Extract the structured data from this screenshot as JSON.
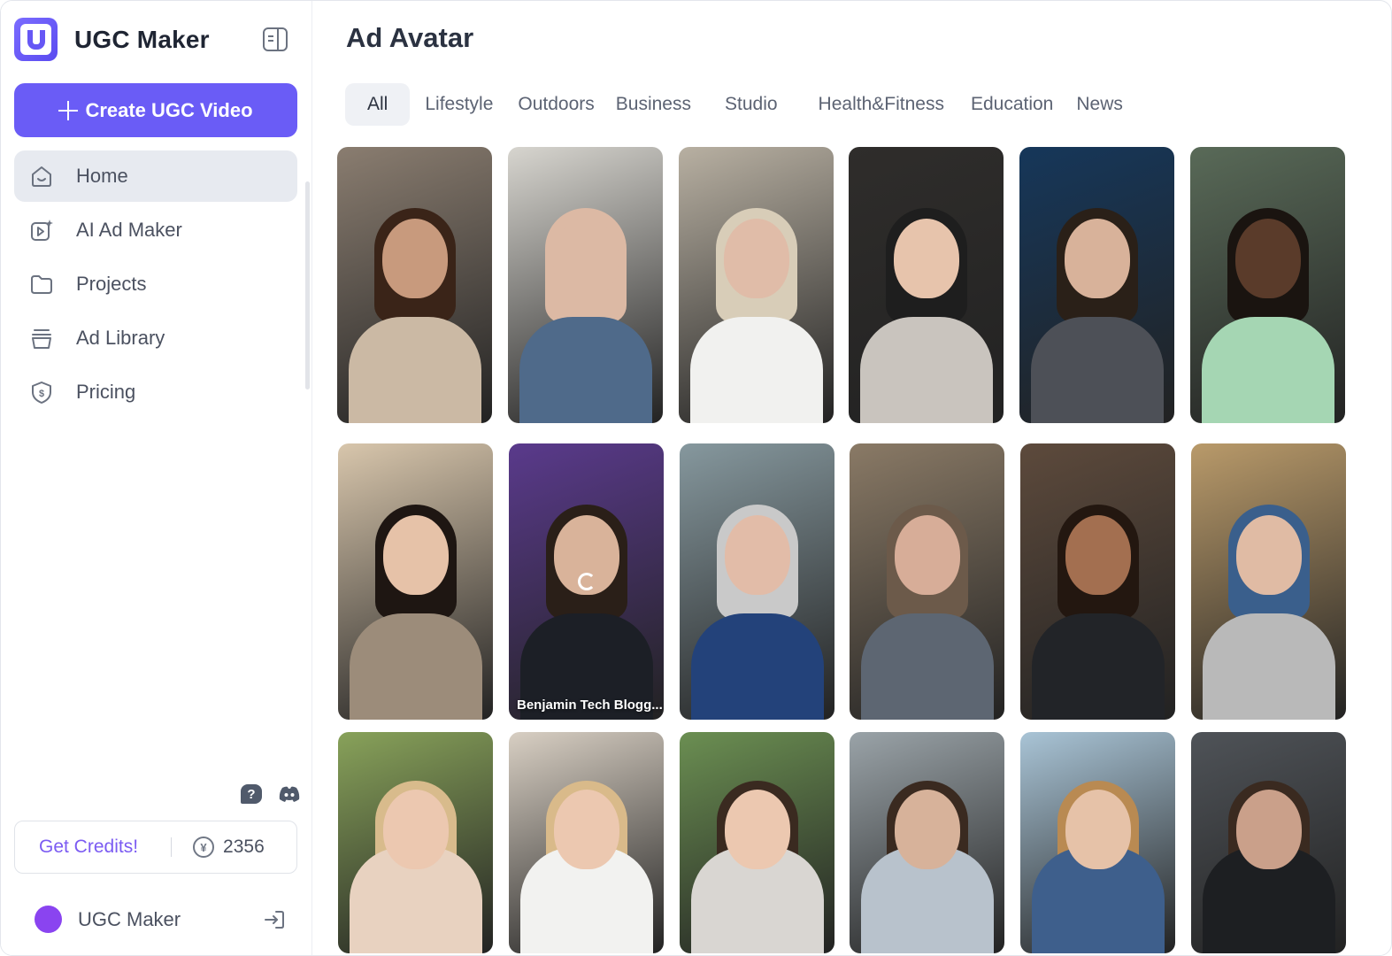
{
  "app": {
    "name": "UGC Maker"
  },
  "sidebar": {
    "create_button": "Create UGC Video",
    "items": [
      {
        "label": "Home",
        "icon": "home-icon",
        "active": true
      },
      {
        "label": "AI Ad Maker",
        "icon": "video-sparkle-icon",
        "active": false
      },
      {
        "label": "Projects",
        "icon": "folder-icon",
        "active": false
      },
      {
        "label": "Ad Library",
        "icon": "stack-icon",
        "active": false
      },
      {
        "label": "Pricing",
        "icon": "dollar-shield-icon",
        "active": false
      }
    ],
    "credits": {
      "get_label": "Get Credits!",
      "count": "2356"
    },
    "user": {
      "name": "UGC Maker",
      "avatar_color": "#8a44f0"
    }
  },
  "main": {
    "title": "Ad Avatar",
    "tabs": [
      "All",
      "Lifestyle",
      "Outdoors",
      "Business",
      "Studio",
      "Health&Fitness",
      "Education",
      "News"
    ],
    "active_tab": "All",
    "avatars": [
      {
        "caption": "",
        "bg": "#8a7d70",
        "skin": "#c89a7d",
        "hair": "#3a2418",
        "top": "#cbb9a4"
      },
      {
        "caption": "",
        "bg": "#d7d5cf",
        "skin": "#dcb9a4",
        "hair": "#dcb9a4",
        "top": "#4f6a8a"
      },
      {
        "caption": "",
        "bg": "#b8b0a2",
        "skin": "#e0bca8",
        "hair": "#d8cdb8",
        "top": "#f1f1ef"
      },
      {
        "caption": "",
        "bg": "#2f2d2b",
        "skin": "#e7c4ac",
        "hair": "#1e1e1e",
        "top": "#c9c4be"
      },
      {
        "caption": "",
        "bg": "#16375a",
        "skin": "#d8b29a",
        "hair": "#2a2018",
        "top": "#4d5057"
      },
      {
        "caption": "",
        "bg": "#596a58",
        "skin": "#5a3b2a",
        "hair": "#1a1410",
        "top": "#a5d6b3"
      },
      {
        "caption": "",
        "bg": "#d8c6ac",
        "skin": "#e6c2a8",
        "hair": "#1e1612",
        "top": "#9c8c7a"
      },
      {
        "caption": "Benjamin Tech Blogg...",
        "bg": "#5a3a8c",
        "skin": "#d9b39a",
        "hair": "#2a1f18",
        "top": "#1c1f26",
        "loading": true
      },
      {
        "caption": "",
        "bg": "#86989e",
        "skin": "#e2bca8",
        "hair": "#c9c9c9",
        "top": "#23427a"
      },
      {
        "caption": "",
        "bg": "#8a7a66",
        "skin": "#d7ad98",
        "hair": "#6c5a4a",
        "top": "#5d6672"
      },
      {
        "caption": "",
        "bg": "#5d4a3c",
        "skin": "#a36f50",
        "hair": "#231710",
        "top": "#222428"
      },
      {
        "caption": "",
        "bg": "#b99a6a",
        "skin": "#e0bba4",
        "hair": "#3a5f8c",
        "top": "#b9b9b9"
      },
      {
        "caption": "",
        "bg": "#88a25a",
        "skin": "#ecc8b0",
        "hair": "#d8bb8c",
        "top": "#e8d2c0"
      },
      {
        "caption": "",
        "bg": "#d8cfc3",
        "skin": "#ecc8b0",
        "hair": "#d9ba8a",
        "top": "#f2f2f0"
      },
      {
        "caption": "",
        "bg": "#6b8f52",
        "skin": "#ecc8b0",
        "hair": "#3a2a20",
        "top": "#d9d6d2"
      },
      {
        "caption": "",
        "bg": "#9aa3a8",
        "skin": "#d7b29a",
        "hair": "#3a2a20",
        "top": "#b8c2cc"
      },
      {
        "caption": "",
        "bg": "#a9c4d6",
        "skin": "#e6c2a8",
        "hair": "#b98a52",
        "top": "#3e5f8c"
      },
      {
        "caption": "",
        "bg": "#4f5358",
        "skin": "#caa08a",
        "hair": "#3a2a20",
        "top": "#1d1f22"
      }
    ]
  }
}
